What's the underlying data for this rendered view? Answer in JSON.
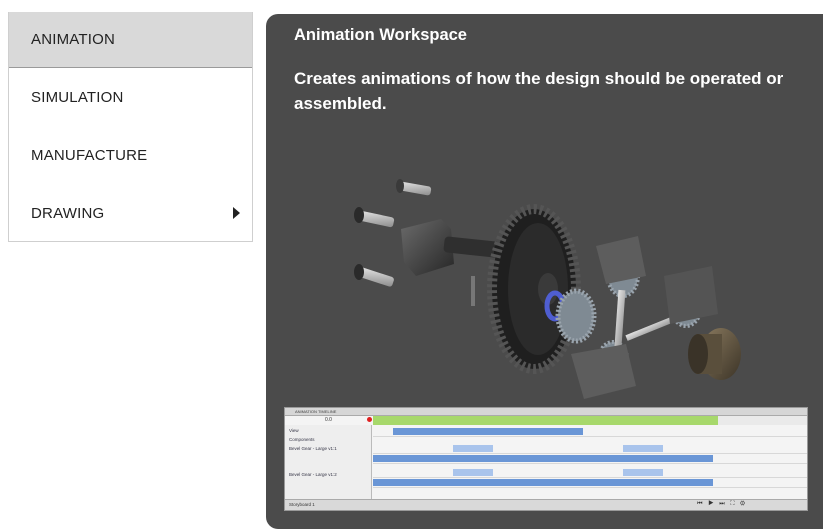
{
  "menu": {
    "items": [
      {
        "label": "ANIMATION",
        "active": true,
        "has_submenu": false
      },
      {
        "label": "SIMULATION",
        "active": false,
        "has_submenu": false
      },
      {
        "label": "MANUFACTURE",
        "active": false,
        "has_submenu": false
      },
      {
        "label": "DRAWING",
        "active": false,
        "has_submenu": true
      }
    ]
  },
  "panel": {
    "title": "Animation Workspace",
    "description": "Creates animations of how the design should be operated or assembled."
  },
  "timeline": {
    "header": "ANIMATION TIMELINE",
    "time": "0.0",
    "tree": [
      "View",
      "Components",
      "Bevel Gear - Large v1:1",
      "Bevel Gear - Large v1:2"
    ],
    "footer": "Storyboard 1",
    "controls": "⏮ ▶ ⏭ ⛶ ⚙"
  },
  "colors": {
    "panel_bg": "#4b4b4b",
    "active_item_bg": "#d9d9d9",
    "timeline_ruler": "#a7d86b",
    "track_bar": "#6a96d6"
  }
}
